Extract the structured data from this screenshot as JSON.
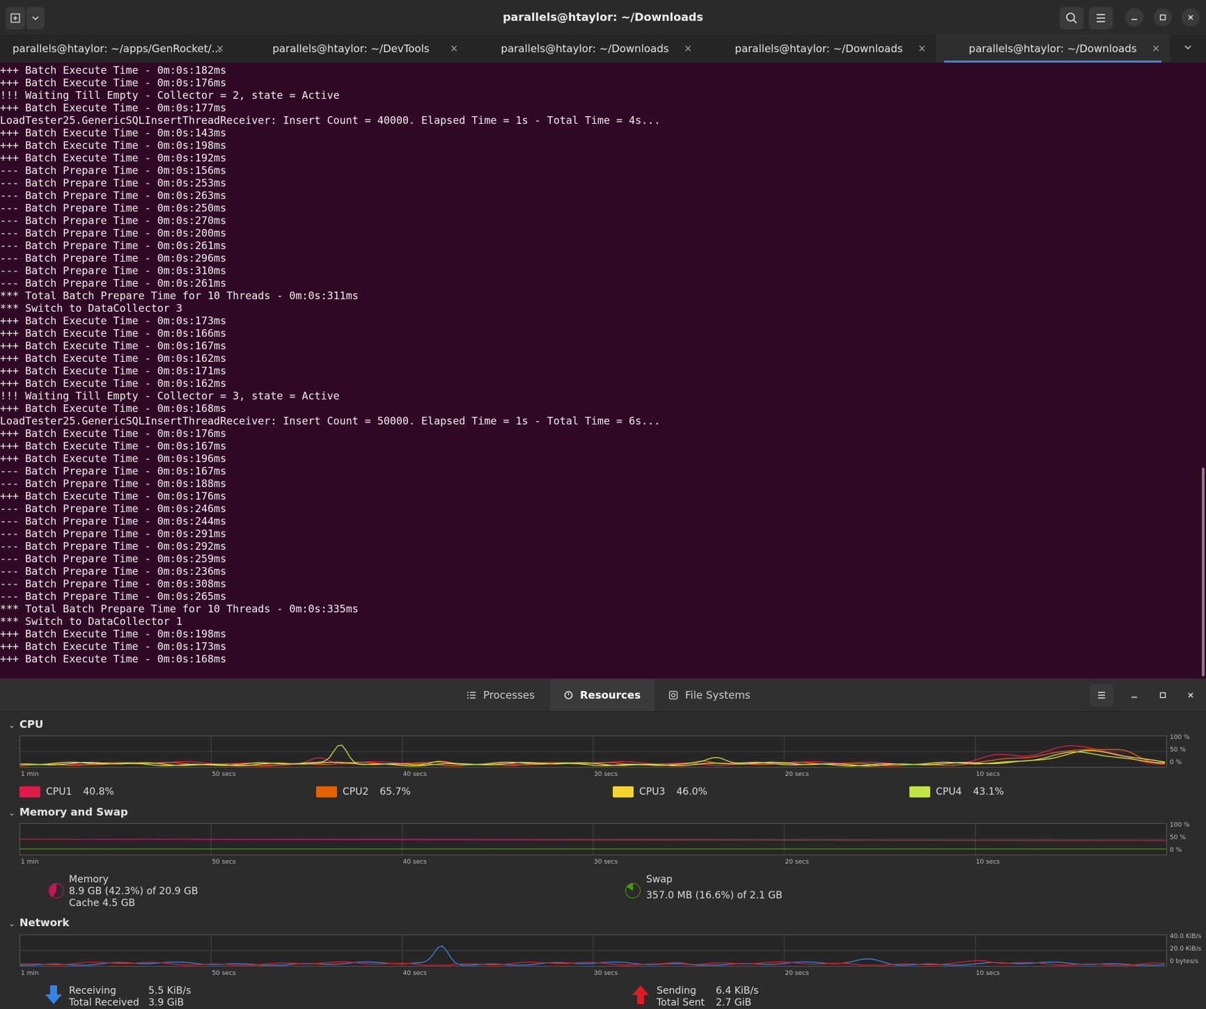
{
  "window": {
    "title": "parallels@htaylor: ~/Downloads"
  },
  "tabs": [
    {
      "label": "parallels@htaylor: ~/apps/GenRocket/..."
    },
    {
      "label": "parallels@htaylor: ~/DevTools"
    },
    {
      "label": "parallels@htaylor: ~/Downloads"
    },
    {
      "label": "parallels@htaylor: ~/Downloads"
    },
    {
      "label": "parallels@htaylor: ~/Downloads"
    }
  ],
  "tab_close_glyph": "×",
  "terminal_lines": [
    "+++ Batch Execute Time - 0m:0s:182ms",
    "+++ Batch Execute Time - 0m:0s:176ms",
    "!!! Waiting Till Empty - Collector = 2, state = Active",
    "+++ Batch Execute Time - 0m:0s:177ms",
    "LoadTester25.GenericSQLInsertThreadReceiver: Insert Count = 40000. Elapsed Time = 1s - Total Time = 4s...",
    "+++ Batch Execute Time - 0m:0s:143ms",
    "+++ Batch Execute Time - 0m:0s:198ms",
    "+++ Batch Execute Time - 0m:0s:192ms",
    "--- Batch Prepare Time - 0m:0s:156ms",
    "--- Batch Prepare Time - 0m:0s:253ms",
    "--- Batch Prepare Time - 0m:0s:263ms",
    "--- Batch Prepare Time - 0m:0s:250ms",
    "--- Batch Prepare Time - 0m:0s:270ms",
    "--- Batch Prepare Time - 0m:0s:200ms",
    "--- Batch Prepare Time - 0m:0s:261ms",
    "--- Batch Prepare Time - 0m:0s:296ms",
    "--- Batch Prepare Time - 0m:0s:310ms",
    "--- Batch Prepare Time - 0m:0s:261ms",
    "*** Total Batch Prepare Time for 10 Threads - 0m:0s:311ms",
    "*** Switch to DataCollector 3",
    "+++ Batch Execute Time - 0m:0s:173ms",
    "+++ Batch Execute Time - 0m:0s:166ms",
    "+++ Batch Execute Time - 0m:0s:167ms",
    "+++ Batch Execute Time - 0m:0s:162ms",
    "+++ Batch Execute Time - 0m:0s:171ms",
    "+++ Batch Execute Time - 0m:0s:162ms",
    "!!! Waiting Till Empty - Collector = 3, state = Active",
    "+++ Batch Execute Time - 0m:0s:168ms",
    "LoadTester25.GenericSQLInsertThreadReceiver: Insert Count = 50000. Elapsed Time = 1s - Total Time = 6s...",
    "+++ Batch Execute Time - 0m:0s:176ms",
    "+++ Batch Execute Time - 0m:0s:167ms",
    "+++ Batch Execute Time - 0m:0s:196ms",
    "--- Batch Prepare Time - 0m:0s:167ms",
    "--- Batch Prepare Time - 0m:0s:188ms",
    "+++ Batch Execute Time - 0m:0s:176ms",
    "--- Batch Prepare Time - 0m:0s:246ms",
    "--- Batch Prepare Time - 0m:0s:244ms",
    "--- Batch Prepare Time - 0m:0s:291ms",
    "--- Batch Prepare Time - 0m:0s:292ms",
    "--- Batch Prepare Time - 0m:0s:259ms",
    "--- Batch Prepare Time - 0m:0s:236ms",
    "--- Batch Prepare Time - 0m:0s:308ms",
    "--- Batch Prepare Time - 0m:0s:265ms",
    "*** Total Batch Prepare Time for 10 Threads - 0m:0s:335ms",
    "*** Switch to DataCollector 1",
    "+++ Batch Execute Time - 0m:0s:198ms",
    "+++ Batch Execute Time - 0m:0s:173ms",
    "+++ Batch Execute Time - 0m:0s:168ms"
  ],
  "sysmon": {
    "tabs": {
      "processes": "Processes",
      "resources": "Resources",
      "filesystems": "File Systems"
    },
    "x_labels": [
      "1 min",
      "50 secs",
      "40 secs",
      "30 secs",
      "20 secs",
      "10 secs"
    ],
    "cpu": {
      "title": "CPU",
      "y_labels": [
        "100 %",
        "50 %",
        "0 %"
      ],
      "cores": [
        {
          "name": "CPU1",
          "value": "40.8%",
          "color": "#e01b4a"
        },
        {
          "name": "CPU2",
          "value": "65.7%",
          "color": "#e66100"
        },
        {
          "name": "CPU3",
          "value": "46.0%",
          "color": "#f6d32d"
        },
        {
          "name": "CPU4",
          "value": "43.1%",
          "color": "#c0e345"
        }
      ]
    },
    "memory": {
      "title": "Memory and Swap",
      "y_labels": [
        "100 %",
        "50 %",
        "0 %"
      ],
      "mem_label": "Memory",
      "mem_value": "8.9 GB (42.3%) of 20.9 GB",
      "cache": "Cache 4.5 GB",
      "mem_color": "#c2185b",
      "swap_label": "Swap",
      "swap_value": "357.0 MB (16.6%) of 2.1 GB",
      "swap_color": "#4e9a06"
    },
    "network": {
      "title": "Network",
      "y_labels": [
        "40.0 KiB/s",
        "20.0 KiB/s",
        "0 bytes/s"
      ],
      "receiving_label": "Receiving",
      "receiving_value": "5.5 KiB/s",
      "total_received_label": "Total Received",
      "total_received_value": "3.9 GiB",
      "sending_label": "Sending",
      "sending_value": "6.4 KiB/s",
      "total_sent_label": "Total Sent",
      "total_sent_value": "2.7 GiB",
      "recv_color": "#3584e4",
      "send_color": "#e01b24"
    }
  }
}
